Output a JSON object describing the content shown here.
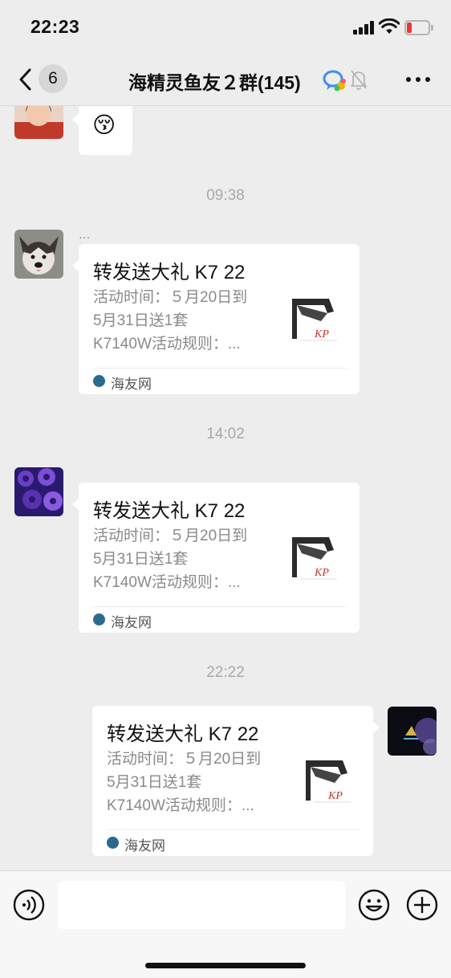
{
  "status_bar": {
    "time": "22:23"
  },
  "nav": {
    "unread_count": "6",
    "title": "海精灵鱼友２群(145)"
  },
  "messages": [
    {
      "type": "emoji",
      "content": "😚"
    },
    {
      "type": "timestamp",
      "text": "09:38"
    },
    {
      "type": "link_card",
      "sender_name": "...",
      "title": "转发送大礼 K7 22",
      "desc_lines": [
        "活动时间：５月20日到",
        "5月31日送1套",
        "K7140W活动规则：..."
      ],
      "source": "海友网",
      "thumb_text": "KP"
    },
    {
      "type": "timestamp",
      "text": "14:02"
    },
    {
      "type": "link_card",
      "title": "转发送大礼 K7 22",
      "desc_lines": [
        "活动时间：５月20日到",
        "5月31日送1套",
        "K7140W活动规则：..."
      ],
      "source": "海友网",
      "thumb_text": "KP"
    },
    {
      "type": "timestamp",
      "text": "22:22"
    },
    {
      "type": "link_card_self",
      "title": "转发送大礼 K7 22",
      "desc_lines": [
        "活动时间：５月20日到",
        "5月31日送1套",
        "K7140W活动规则：..."
      ],
      "source": "海友网",
      "thumb_text": "KP"
    }
  ],
  "input": {
    "placeholder": ""
  },
  "colors": {
    "background": "#ededed",
    "bubble": "#ffffff",
    "source_logo": "#2b6a8f",
    "battery_low": "#e53935"
  }
}
